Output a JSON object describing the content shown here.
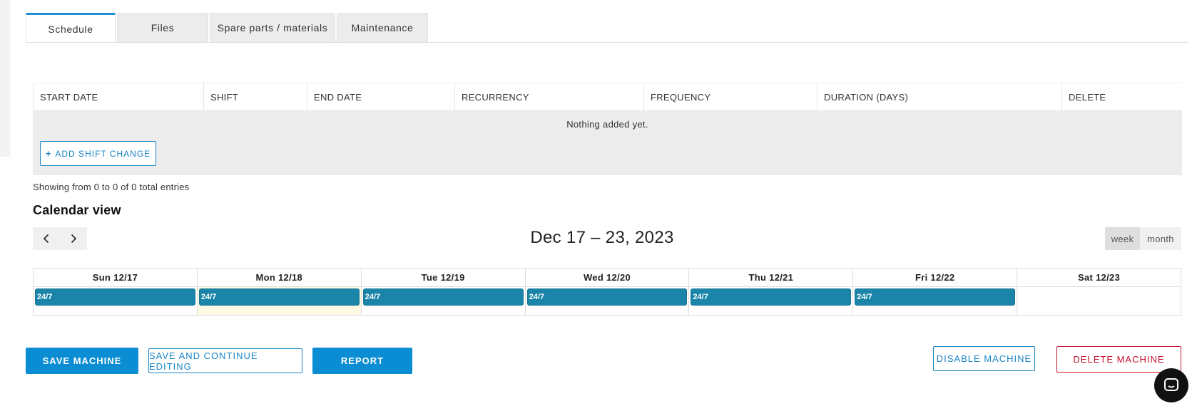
{
  "tabs": [
    {
      "label": "Schedule",
      "active": true
    },
    {
      "label": "Files",
      "active": false
    },
    {
      "label": "Spare parts / materials",
      "active": false
    },
    {
      "label": "Maintenance",
      "active": false
    }
  ],
  "table": {
    "columns": [
      "START DATE",
      "SHIFT",
      "END DATE",
      "RECURRENCY",
      "FREQUENCY",
      "DURATION (DAYS)",
      "DELETE"
    ],
    "empty_message": "Nothing added yet.",
    "add_button": {
      "icon": "+",
      "label": "ADD SHIFT CHANGE"
    },
    "showing": "Showing from 0 to 0 of 0 total entries"
  },
  "calendar": {
    "title": "Calendar view",
    "range": "Dec 17 – 23, 2023",
    "prev_icon": "chevron-left-icon",
    "next_icon": "chevron-right-icon",
    "views": [
      {
        "label": "week",
        "active": true
      },
      {
        "label": "month",
        "active": false
      }
    ],
    "days": [
      {
        "label": "Sun 12/17",
        "event": "24/7",
        "today": false
      },
      {
        "label": "Mon 12/18",
        "event": "24/7",
        "today": true
      },
      {
        "label": "Tue 12/19",
        "event": "24/7",
        "today": false
      },
      {
        "label": "Wed 12/20",
        "event": "24/7",
        "today": false
      },
      {
        "label": "Thu 12/21",
        "event": "24/7",
        "today": false
      },
      {
        "label": "Fri 12/22",
        "event": "24/7",
        "today": false
      },
      {
        "label": "Sat 12/23",
        "event": "",
        "today": false
      }
    ],
    "event_color": "#1a85a9"
  },
  "actions": {
    "save": "SAVE MACHINE",
    "save_continue": "SAVE AND CONTINUE EDITING",
    "report": "REPORT",
    "disable": "DISABLE MACHINE",
    "delete": "DELETE MACHINE"
  },
  "colors": {
    "accent": "#0b8dd3",
    "danger": "#c8102e"
  },
  "chat_icon": "chat-icon"
}
